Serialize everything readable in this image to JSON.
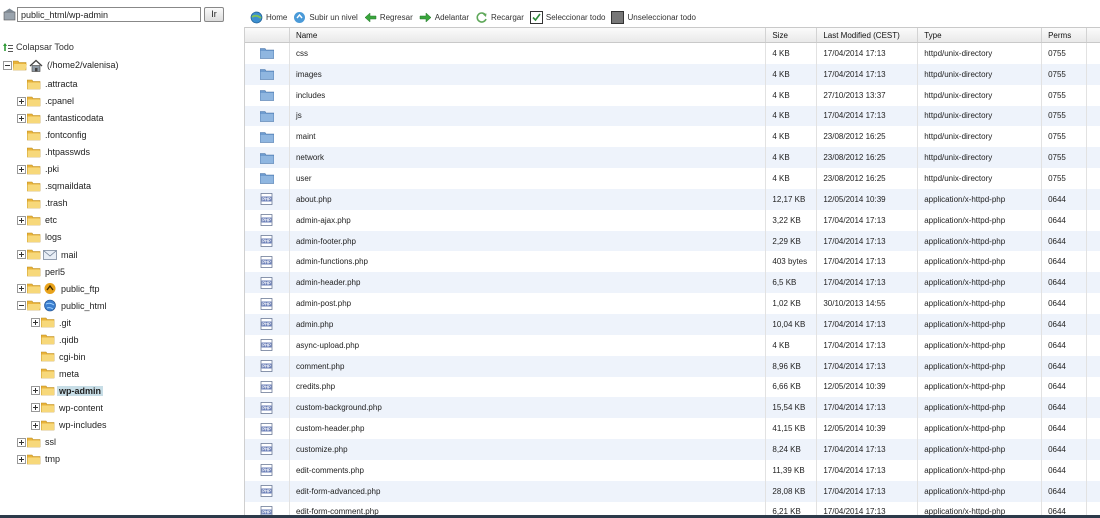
{
  "path": {
    "value": "public_html/wp-admin",
    "go_label": "Ir"
  },
  "tree": {
    "collapse_label": "Colapsar Todo",
    "root_label": "(/home2/valenisa)",
    "nodes": [
      {
        "label": ".attracta",
        "toggle": "none",
        "icon": "none",
        "selected": false
      },
      {
        "label": ".cpanel",
        "toggle": "plus",
        "icon": "none",
        "selected": false
      },
      {
        "label": ".fantasticodata",
        "toggle": "plus",
        "icon": "none",
        "selected": false
      },
      {
        "label": ".fontconfig",
        "toggle": "none",
        "icon": "none",
        "selected": false
      },
      {
        "label": ".htpasswds",
        "toggle": "none",
        "icon": "none",
        "selected": false
      },
      {
        "label": ".pki",
        "toggle": "plus",
        "icon": "none",
        "selected": false
      },
      {
        "label": ".sqmaildata",
        "toggle": "none",
        "icon": "none",
        "selected": false
      },
      {
        "label": ".trash",
        "toggle": "none",
        "icon": "none",
        "selected": false
      },
      {
        "label": "etc",
        "toggle": "plus",
        "icon": "none",
        "selected": false
      },
      {
        "label": "logs",
        "toggle": "none",
        "icon": "none",
        "selected": false
      },
      {
        "label": "mail",
        "toggle": "plus",
        "icon": "mail",
        "selected": false
      },
      {
        "label": "perl5",
        "toggle": "none",
        "icon": "none",
        "selected": false
      },
      {
        "label": "public_ftp",
        "toggle": "plus",
        "icon": "ftp",
        "selected": false
      },
      {
        "label": "public_html",
        "toggle": "minus",
        "icon": "globe",
        "selected": false
      },
      {
        "label": ".git",
        "toggle": "plus",
        "icon": "none",
        "selected": false
      },
      {
        "label": ".qidb",
        "toggle": "none",
        "icon": "none",
        "selected": false
      },
      {
        "label": "cgi-bin",
        "toggle": "none",
        "icon": "none",
        "selected": false
      },
      {
        "label": "meta",
        "toggle": "none",
        "icon": "none",
        "selected": false
      },
      {
        "label": "wp-admin",
        "toggle": "plus",
        "icon": "none",
        "selected": true
      },
      {
        "label": "wp-content",
        "toggle": "plus",
        "icon": "none",
        "selected": false
      },
      {
        "label": "wp-includes",
        "toggle": "plus",
        "icon": "none",
        "selected": false
      },
      {
        "label": "ssl",
        "toggle": "plus",
        "icon": "none",
        "selected": false
      },
      {
        "label": "tmp",
        "toggle": "plus",
        "icon": "none",
        "selected": false
      }
    ]
  },
  "toolbar": {
    "home": "Home",
    "up": "Subir un nivel",
    "back": "Regresar",
    "forward": "Adelantar",
    "reload": "Recargar",
    "select_all": "Seleccionar todo",
    "unselect_all": "Unseleccionar todo"
  },
  "table": {
    "headers": [
      "Name",
      "Size",
      "Last Modified (CEST)",
      "Type",
      "Perms"
    ],
    "rows": [
      {
        "type_icon": "folder-icon",
        "name": "css",
        "size": "4 KB",
        "modified": "17/04/2014 17:13",
        "type": "httpd/unix-directory",
        "perms": "0755"
      },
      {
        "type_icon": "folder-icon",
        "name": "images",
        "size": "4 KB",
        "modified": "17/04/2014 17:13",
        "type": "httpd/unix-directory",
        "perms": "0755"
      },
      {
        "type_icon": "folder-icon",
        "name": "includes",
        "size": "4 KB",
        "modified": "27/10/2013 13:37",
        "type": "httpd/unix-directory",
        "perms": "0755"
      },
      {
        "type_icon": "folder-icon",
        "name": "js",
        "size": "4 KB",
        "modified": "17/04/2014 17:13",
        "type": "httpd/unix-directory",
        "perms": "0755"
      },
      {
        "type_icon": "folder-icon",
        "name": "maint",
        "size": "4 KB",
        "modified": "23/08/2012 16:25",
        "type": "httpd/unix-directory",
        "perms": "0755"
      },
      {
        "type_icon": "folder-icon",
        "name": "network",
        "size": "4 KB",
        "modified": "23/08/2012 16:25",
        "type": "httpd/unix-directory",
        "perms": "0755"
      },
      {
        "type_icon": "folder-icon",
        "name": "user",
        "size": "4 KB",
        "modified": "23/08/2012 16:25",
        "type": "httpd/unix-directory",
        "perms": "0755"
      },
      {
        "type_icon": "php-file-icon",
        "name": "about.php",
        "size": "12,17 KB",
        "modified": "12/05/2014 10:39",
        "type": "application/x-httpd-php",
        "perms": "0644"
      },
      {
        "type_icon": "php-file-icon",
        "name": "admin-ajax.php",
        "size": "3,22 KB",
        "modified": "17/04/2014 17:13",
        "type": "application/x-httpd-php",
        "perms": "0644"
      },
      {
        "type_icon": "php-file-icon",
        "name": "admin-footer.php",
        "size": "2,29 KB",
        "modified": "17/04/2014 17:13",
        "type": "application/x-httpd-php",
        "perms": "0644"
      },
      {
        "type_icon": "php-file-icon",
        "name": "admin-functions.php",
        "size": "403 bytes",
        "modified": "17/04/2014 17:13",
        "type": "application/x-httpd-php",
        "perms": "0644"
      },
      {
        "type_icon": "php-file-icon",
        "name": "admin-header.php",
        "size": "6,5 KB",
        "modified": "17/04/2014 17:13",
        "type": "application/x-httpd-php",
        "perms": "0644"
      },
      {
        "type_icon": "php-file-icon",
        "name": "admin-post.php",
        "size": "1,02 KB",
        "modified": "30/10/2013 14:55",
        "type": "application/x-httpd-php",
        "perms": "0644"
      },
      {
        "type_icon": "php-file-icon",
        "name": "admin.php",
        "size": "10,04 KB",
        "modified": "17/04/2014 17:13",
        "type": "application/x-httpd-php",
        "perms": "0644"
      },
      {
        "type_icon": "php-file-icon",
        "name": "async-upload.php",
        "size": "4 KB",
        "modified": "17/04/2014 17:13",
        "type": "application/x-httpd-php",
        "perms": "0644"
      },
      {
        "type_icon": "php-file-icon",
        "name": "comment.php",
        "size": "8,96 KB",
        "modified": "17/04/2014 17:13",
        "type": "application/x-httpd-php",
        "perms": "0644"
      },
      {
        "type_icon": "php-file-icon",
        "name": "credits.php",
        "size": "6,66 KB",
        "modified": "12/05/2014 10:39",
        "type": "application/x-httpd-php",
        "perms": "0644"
      },
      {
        "type_icon": "php-file-icon",
        "name": "custom-background.php",
        "size": "15,54 KB",
        "modified": "17/04/2014 17:13",
        "type": "application/x-httpd-php",
        "perms": "0644"
      },
      {
        "type_icon": "php-file-icon",
        "name": "custom-header.php",
        "size": "41,15 KB",
        "modified": "12/05/2014 10:39",
        "type": "application/x-httpd-php",
        "perms": "0644"
      },
      {
        "type_icon": "php-file-icon",
        "name": "customize.php",
        "size": "8,24 KB",
        "modified": "17/04/2014 17:13",
        "type": "application/x-httpd-php",
        "perms": "0644"
      },
      {
        "type_icon": "php-file-icon",
        "name": "edit-comments.php",
        "size": "11,39 KB",
        "modified": "17/04/2014 17:13",
        "type": "application/x-httpd-php",
        "perms": "0644"
      },
      {
        "type_icon": "php-file-icon",
        "name": "edit-form-advanced.php",
        "size": "28,08 KB",
        "modified": "17/04/2014 17:13",
        "type": "application/x-httpd-php",
        "perms": "0644"
      },
      {
        "type_icon": "php-file-icon",
        "name": "edit-form-comment.php",
        "size": "6,21 KB",
        "modified": "17/04/2014 17:13",
        "type": "application/x-httpd-php",
        "perms": "0644"
      }
    ]
  },
  "colors": {
    "accent": "#4a7fc1",
    "row_alt": "#eef3fb",
    "selected": "#c7dde6",
    "folder": "#f0c24a"
  }
}
